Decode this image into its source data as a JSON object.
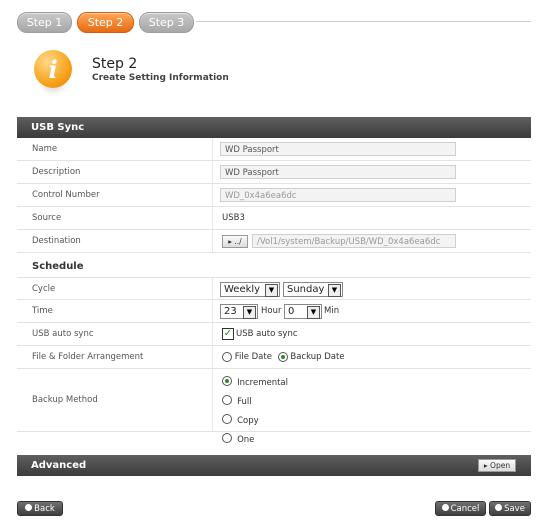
{
  "steps": [
    "Step 1",
    "Step 2",
    "Step 3"
  ],
  "header": {
    "title": "Step 2",
    "subtitle": "Create Setting Information"
  },
  "usb_sync": {
    "title": "USB Sync",
    "fields": {
      "name": {
        "label": "Name",
        "value": "WD Passport"
      },
      "description": {
        "label": "Description",
        "value": "WD Passport"
      },
      "control_number": {
        "label": "Control Number",
        "value": "WD_0x4a6ea6dc"
      },
      "source": {
        "label": "Source",
        "value": "USB3"
      },
      "destination": {
        "label": "Destination",
        "browse_label": "▸ ../",
        "value": "/Vol1/system/Backup/USB/WD_0x4a6ea6dc"
      }
    }
  },
  "schedule": {
    "title": "Schedule",
    "cycle": {
      "label": "Cycle",
      "frequency": "Weekly",
      "day": "Sunday"
    },
    "time": {
      "label": "Time",
      "hour": "23",
      "hour_unit": "Hour",
      "minute": "0",
      "minute_unit": "Min"
    },
    "auto_sync": {
      "label": "USB auto sync",
      "checkbox_label": "USB auto sync",
      "checked": true
    },
    "arrangement": {
      "label": "File & Folder Arrangement",
      "options": [
        "File Date",
        "Backup Date"
      ],
      "selected": "Backup Date"
    },
    "backup_method": {
      "label": "Backup Method",
      "options": [
        "Incremental",
        "Full",
        "Copy",
        "One"
      ],
      "selected": "Incremental"
    }
  },
  "advanced": {
    "title": "Advanced",
    "open_label": "▸ Open"
  },
  "footer": {
    "back": "Back",
    "cancel": "Cancel",
    "save": "Save"
  },
  "colors": {
    "accent": "#f07b1e",
    "bar": "#4a4a4a",
    "radio_on": "#2e8a2e"
  }
}
